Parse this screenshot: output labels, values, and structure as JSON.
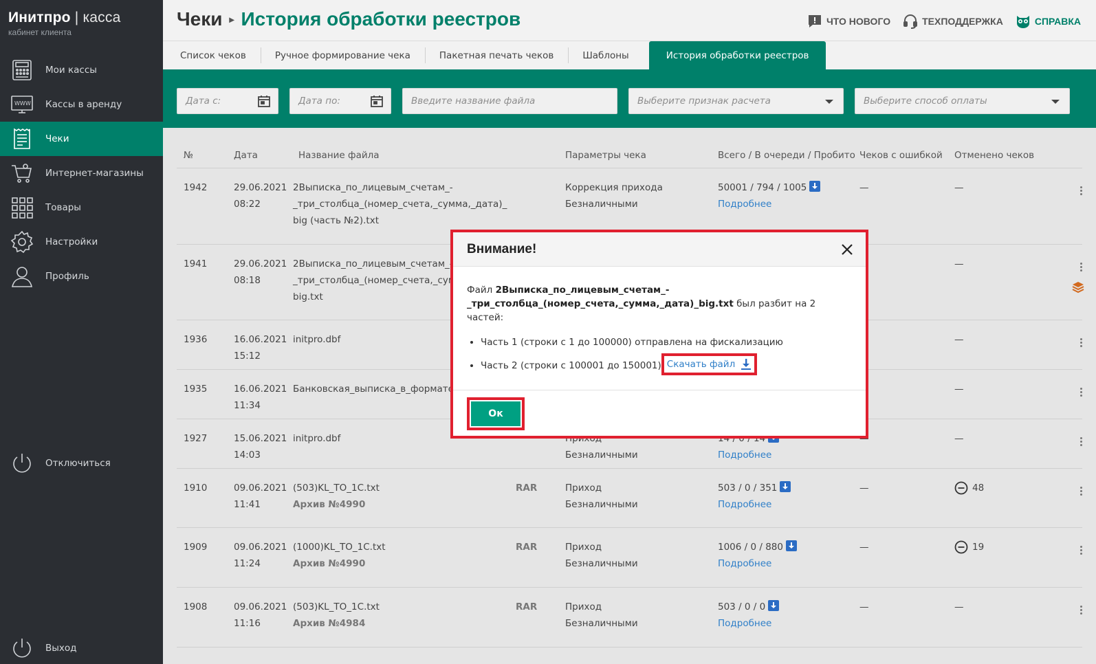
{
  "brand": {
    "title": "Инитпро",
    "title_suffix": "| касса",
    "subtitle": "кабинет клиента"
  },
  "sidebar": {
    "items": [
      {
        "label": "Мои кассы",
        "icon": "cash-register-icon"
      },
      {
        "label": "Кассы в аренду",
        "icon": "www-icon"
      },
      {
        "label": "Чеки",
        "icon": "receipt-icon",
        "active": true
      },
      {
        "label": "Интернет-магазины",
        "icon": "cart-icon"
      },
      {
        "label": "Товары",
        "icon": "grid-icon"
      },
      {
        "label": "Настройки",
        "icon": "gear-icon"
      },
      {
        "label": "Профиль",
        "icon": "user-icon"
      }
    ],
    "disconnect": "Отключиться",
    "logout": "Выход"
  },
  "header": {
    "crumb_root": "Чеки",
    "crumb_current": "История обработки реестров",
    "actions": [
      {
        "label": "Что нового",
        "icon": "chat-icon"
      },
      {
        "label": "Техподдержка",
        "icon": "headset-icon"
      },
      {
        "label": "Справка",
        "icon": "owl-icon"
      }
    ]
  },
  "tabs": [
    "Список чеков",
    "Ручное формирование чека",
    "Пакетная печать чеков",
    "Шаблоны",
    "История обработки реестров"
  ],
  "active_tab": 4,
  "filters": {
    "date_from": "Дата с:",
    "date_to": "Дата по:",
    "file_name": "Введите название файла",
    "calc_sign": "Выберите признак расчета",
    "payment": "Выберите способ оплаты"
  },
  "table": {
    "headers": [
      "№",
      "Дата",
      "Название файла",
      "Параметры чека",
      "Всего / В очереди / Пробито",
      "Чеков с ошибкой",
      "Отменено чеков"
    ],
    "rows": [
      {
        "num": "1942",
        "date": "29.06.2021",
        "time": "08:22",
        "file": [
          "2Выписка_по_лицевым_счетам_-",
          "_три_столбца_(номер_счета,_сумма,_дата)_",
          "big (часть №2).txt"
        ],
        "archive": "",
        "rar": "",
        "param1": "Коррекция прихода",
        "param2": "Безналичными",
        "totals": "50001 / 794 / 1005",
        "details": "Подробнее",
        "errors": "—",
        "cancelled": "—"
      },
      {
        "num": "1941",
        "date": "29.06.2021",
        "time": "08:18",
        "file": [
          "2Выписка_по_лицевым_счетам_-",
          "_три_столбца_(номер_счета,_сум",
          "big.txt"
        ],
        "archive": "",
        "rar": "",
        "param1": "",
        "param2": "",
        "totals": "",
        "details": "",
        "errors": "—",
        "cancelled": "—"
      },
      {
        "num": "1936",
        "date": "16.06.2021",
        "time": "15:12",
        "file": [
          "initpro.dbf"
        ],
        "archive": "",
        "rar": "",
        "param1": "",
        "param2": "",
        "totals": "",
        "details": "",
        "errors": "—",
        "cancelled": "—"
      },
      {
        "num": "1935",
        "date": "16.06.2021",
        "time": "11:34",
        "file": [
          "Банковская_выписка_в_формате"
        ],
        "archive": "",
        "rar": "",
        "param1": "",
        "param2": "",
        "totals": "",
        "details": "",
        "errors": "—",
        "cancelled": "—"
      },
      {
        "num": "1927",
        "date": "15.06.2021",
        "time": "14:03",
        "file": [
          "initpro.dbf"
        ],
        "archive": "",
        "rar": "",
        "param1": "Приход",
        "param2": "Безналичными",
        "totals": "14 / 0 / 14",
        "details": "Подробнее",
        "errors": "—",
        "cancelled": "—"
      },
      {
        "num": "1910",
        "date": "09.06.2021",
        "time": "11:41",
        "file": [
          "(503)KL_TO_1C.txt"
        ],
        "archive": "Архив №4990",
        "rar": "RAR",
        "param1": "Приход",
        "param2": "Безналичными",
        "totals": "503 / 0 / 351",
        "details": "Подробнее",
        "errors": "—",
        "cancelled": "48"
      },
      {
        "num": "1909",
        "date": "09.06.2021",
        "time": "11:24",
        "file": [
          "(1000)KL_TO_1C.txt"
        ],
        "archive": "Архив №4990",
        "rar": "RAR",
        "param1": "Приход",
        "param2": "Безналичными",
        "totals": "1006 / 0 / 880",
        "details": "Подробнее",
        "errors": "—",
        "cancelled": "19"
      },
      {
        "num": "1908",
        "date": "09.06.2021",
        "time": "11:16",
        "file": [
          "(503)KL_TO_1C.txt"
        ],
        "archive": "Архив №4984",
        "rar": "RAR",
        "param1": "Приход",
        "param2": "Безналичными",
        "totals": "503 / 0 / 0",
        "details": "Подробнее",
        "errors": "—",
        "cancelled": "—"
      }
    ]
  },
  "modal": {
    "title": "Внимание!",
    "text_prefix": "Файл",
    "file_bold_1": "2Выписка_по_лицевым_счетам_-",
    "file_bold_2": "_три_столбца_(номер_счета,_сумма,_дата)_big.txt",
    "text_suffix": "был разбит на 2 частей:",
    "part1": "Часть 1 (строки с 1 до 100000) отправлена на фискализацию",
    "part2": "Часть 2 (строки с 100001 до 150001)",
    "download": "Скачать файл",
    "ok": "Ок"
  },
  "colors": {
    "accent": "#00806a",
    "sidebar": "#2b2e33",
    "highlight": "#e0202f",
    "link": "#2f7fc8"
  }
}
